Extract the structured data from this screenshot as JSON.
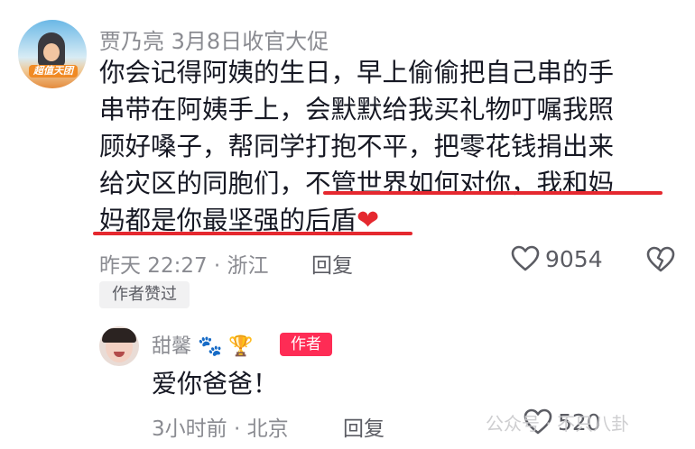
{
  "comment": {
    "author": "贾乃亮",
    "post_date": "3月8日",
    "author_note": "收官大促",
    "avatar_logo_text": "超值天团",
    "text_lines": [
      "你会记得阿姨的生日，早上偷偷把自己串的手",
      "串带在阿姨手上，会默默给我买礼物叮嘱我照",
      "顾好嗓子，帮同学打抱不平，把零花钱捐出来",
      "给灾区的同胞们，",
      "不管世界如何对你，我和妈",
      "妈都是你最坚强的后盾"
    ],
    "time_location": "昨天 22:27 · 浙江",
    "reply_label": "回复",
    "like_count": "9054",
    "author_liked_label": "作者赞过"
  },
  "reply": {
    "author": "甜馨",
    "author_badge": "作者",
    "text": "爱你爸爸！",
    "time_location": "3小时前 · 北京",
    "reply_label": "回复",
    "like_count": "520"
  },
  "watermark": "公众号 · 不只八卦",
  "colors": {
    "highlight_underline": "#e5282f",
    "author_badge": "#fe2c55",
    "meta_text": "#8a8b91"
  },
  "icons": [
    "heart-outline-icon",
    "dislike-heart-icon",
    "paw-icon",
    "trophy-icon",
    "red-heart-emoji"
  ]
}
